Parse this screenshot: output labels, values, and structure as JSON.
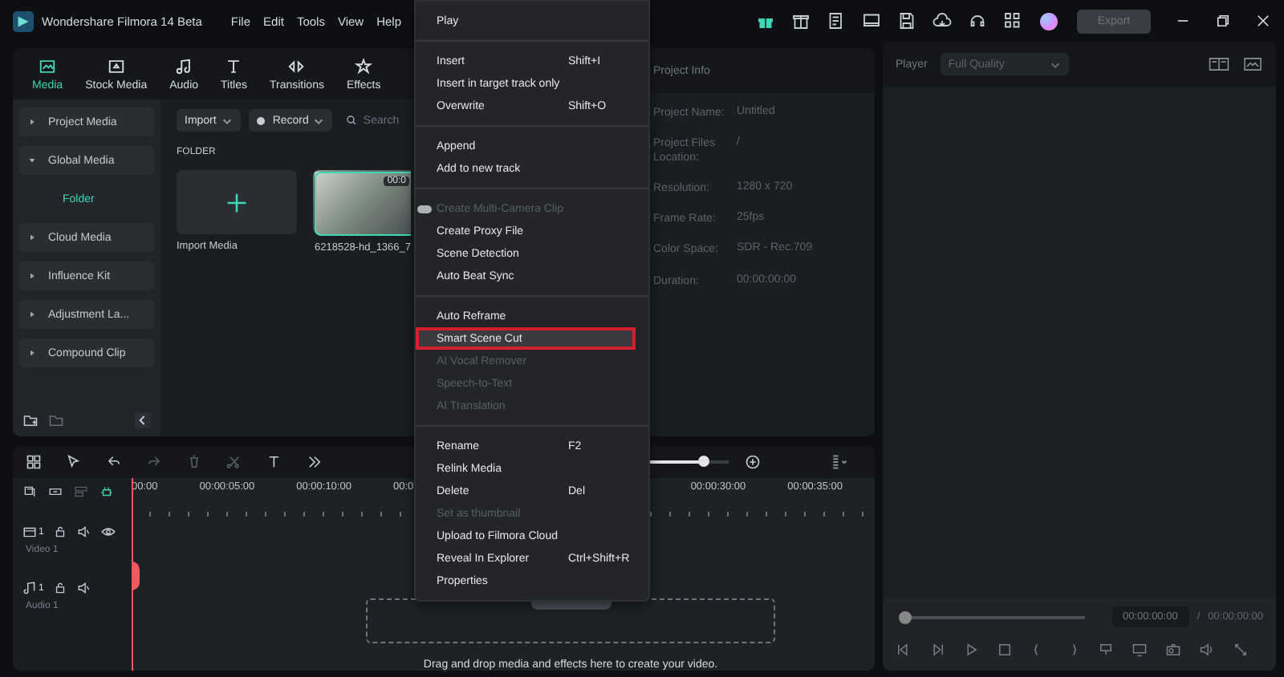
{
  "title_bar": {
    "app_name": "Wondershare Filmora 14 Beta",
    "menus": [
      "File",
      "Edit",
      "Tools",
      "View",
      "Help"
    ],
    "export_button": {
      "label": "Export",
      "disabled": true
    }
  },
  "media_tabs": [
    {
      "label": "Media",
      "selected": true
    },
    {
      "label": "Stock Media",
      "selected": false
    },
    {
      "label": "Audio",
      "selected": false
    },
    {
      "label": "Titles",
      "selected": false
    },
    {
      "label": "Transitions",
      "selected": false
    },
    {
      "label": "Effects",
      "selected": false
    }
  ],
  "library_sidebar": {
    "items": [
      {
        "label": "Project Media",
        "expanded": false
      },
      {
        "label": "Global Media",
        "expanded": true,
        "children": [
          {
            "label": "Folder",
            "selected": true
          }
        ]
      },
      {
        "label": "Cloud Media",
        "expanded": false
      },
      {
        "label": "Influence Kit",
        "expanded": false
      },
      {
        "label": "Adjustment La...",
        "expanded": false
      },
      {
        "label": "Compound Clip",
        "expanded": false
      }
    ]
  },
  "media_toolbar": {
    "import_label": "Import",
    "record_label": "Record",
    "search_placeholder": "Search"
  },
  "folder_heading": "FOLDER",
  "media_items": [
    {
      "kind": "import",
      "label": "Import Media"
    },
    {
      "kind": "clip",
      "label": "6218528-hd_1366_7",
      "duration": "00:0",
      "selected": true
    }
  ],
  "project_info": {
    "title": "Project Info",
    "rows": [
      {
        "label": "Project Name:",
        "value": "Untitled"
      },
      {
        "label": "Project Files Location:",
        "value": "/"
      },
      {
        "label": "Resolution:",
        "value": "1280 x 720"
      },
      {
        "label": "Frame Rate:",
        "value": "25fps"
      },
      {
        "label": "Color Space:",
        "value": "SDR - Rec.709"
      },
      {
        "label": "Duration:",
        "value": "00:00:00:00"
      }
    ]
  },
  "player": {
    "label": "Player",
    "quality": "Full Quality",
    "current_time": "00:00:00:00",
    "separator": "/",
    "total_time": "00:00:00:00",
    "progress": {
      "level": 0
    }
  },
  "timeline": {
    "zoom": {
      "level": 0.72
    },
    "ruler": {
      "left_labels": [
        "00:00",
        "00:00:05:00",
        "00:00:10:00",
        "00:0"
      ],
      "right_labels": [
        "00:00:30:00",
        "00:00:35:00"
      ]
    },
    "tracks": [
      {
        "kind": "video",
        "number": "1",
        "name": "Video 1"
      },
      {
        "kind": "audio",
        "number": "1",
        "name": "Audio 1"
      }
    ],
    "drop_hint": "Drag and drop media and effects here to create your video."
  },
  "context_menu": {
    "groups": [
      [
        {
          "label": "Play",
          "disabled": false,
          "selected": false
        }
      ],
      [
        {
          "label": "Insert",
          "shortcut": "Shift+I",
          "disabled": false,
          "selected": false
        },
        {
          "label": "Insert in target track only",
          "disabled": false,
          "selected": false
        },
        {
          "label": "Overwrite",
          "shortcut": "Shift+O",
          "disabled": false,
          "selected": false
        }
      ],
      [
        {
          "label": "Append",
          "disabled": false,
          "selected": false
        },
        {
          "label": "Add to new track",
          "disabled": false,
          "selected": false
        }
      ],
      [
        {
          "label": "Create Multi-Camera Clip",
          "disabled": true,
          "selected": false,
          "kind": "toggle"
        },
        {
          "label": "Create Proxy File",
          "disabled": false,
          "selected": false
        },
        {
          "label": "Scene Detection",
          "disabled": false,
          "selected": false
        },
        {
          "label": "Auto Beat Sync",
          "disabled": false,
          "selected": false
        }
      ],
      [
        {
          "label": "Auto Reframe",
          "disabled": false,
          "selected": false
        },
        {
          "label": "Smart Scene Cut",
          "disabled": false,
          "selected": true
        },
        {
          "label": "AI Vocal Remover",
          "disabled": true,
          "selected": false
        },
        {
          "label": "Speech-to-Text",
          "disabled": true,
          "selected": false
        },
        {
          "label": "AI Translation",
          "disabled": true,
          "selected": false
        }
      ],
      [
        {
          "label": "Rename",
          "shortcut": "F2",
          "disabled": false,
          "selected": false
        },
        {
          "label": "Relink Media",
          "disabled": false,
          "selected": false
        },
        {
          "label": "Delete",
          "shortcut": "Del",
          "disabled": false,
          "selected": false
        },
        {
          "label": "Set as thumbnail",
          "disabled": true,
          "selected": false
        },
        {
          "label": "Upload to Filmora Cloud",
          "disabled": false,
          "selected": false
        },
        {
          "label": "Reveal In Explorer",
          "shortcut": "Ctrl+Shift+R",
          "disabled": false,
          "selected": false
        },
        {
          "label": "Properties",
          "disabled": false,
          "selected": false
        }
      ]
    ]
  }
}
